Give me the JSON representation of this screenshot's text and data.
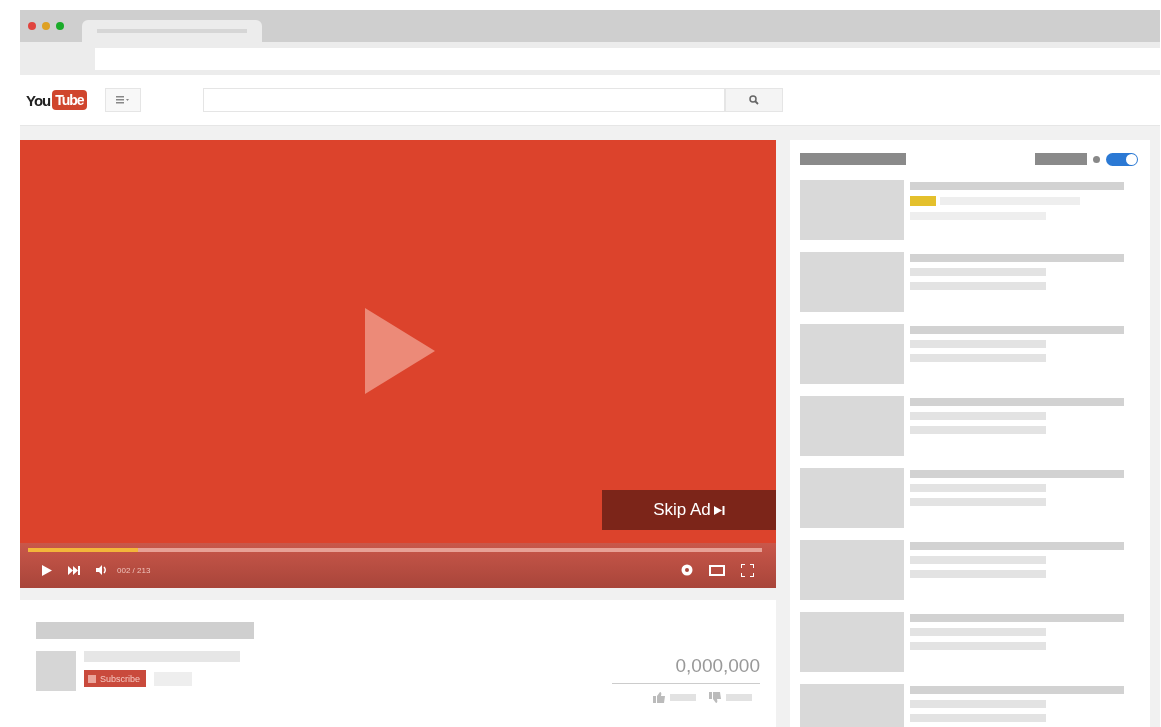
{
  "browser": {
    "dots": [
      {
        "color": "#e0443e"
      },
      {
        "color": "#dea123"
      },
      {
        "color": "#1aab29"
      }
    ]
  },
  "header": {
    "logo_left": "You",
    "logo_right": "Tube"
  },
  "player": {
    "skip_label": "Skip Ad",
    "progress": {
      "level": 0.15
    },
    "time": "002 / 213"
  },
  "info": {
    "subscribe": "Subscribe",
    "views": "0,000,000"
  },
  "sidebar": {
    "autoplay": {
      "on": true
    },
    "items": [
      {
        "kind": "ad"
      },
      {
        "kind": "video"
      },
      {
        "kind": "video"
      },
      {
        "kind": "video"
      },
      {
        "kind": "video"
      },
      {
        "kind": "video"
      },
      {
        "kind": "video"
      },
      {
        "kind": "video"
      }
    ]
  }
}
